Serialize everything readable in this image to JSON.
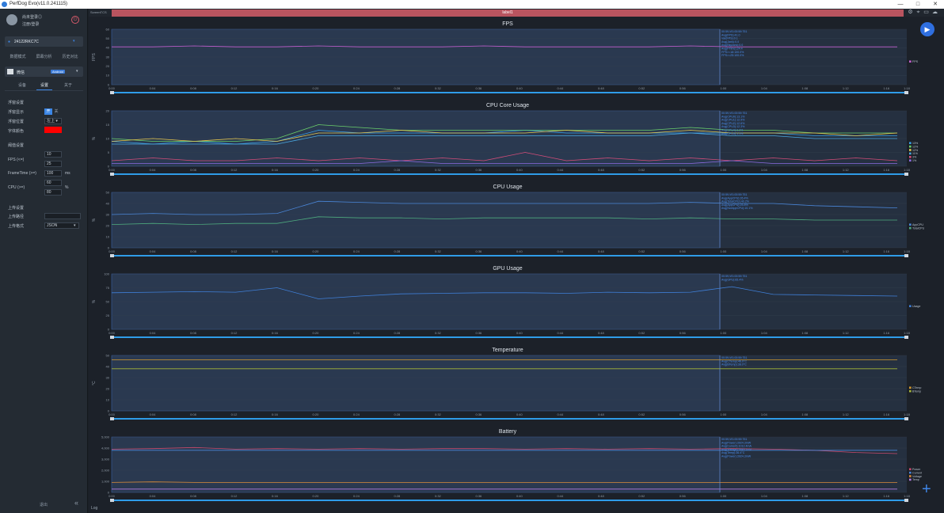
{
  "window": {
    "title": "PerfDog Evo(v11.0.241115)",
    "controls": [
      "—",
      "□",
      "✕"
    ]
  },
  "sidebar": {
    "user_line1": "尚未登录◎",
    "user_line2": "注册/登录",
    "device_name": "24122RKC7C",
    "mode_tabs": [
      "数据模式",
      "屏幕分析",
      "历史对比"
    ],
    "app_name": "微信",
    "app_badge": "Android",
    "sub_tabs": [
      "设备",
      "设置",
      "关于"
    ],
    "float_section": "浮窗设置",
    "float_rows": [
      {
        "label": "浮窗显示",
        "on": "开",
        "off": "关"
      },
      {
        "label": "浮窗位置",
        "value": "左上 ▾"
      },
      {
        "label": "字体颜色",
        "value": ""
      }
    ],
    "threshold_section": "阈值设置",
    "thresholds": [
      {
        "label": "FPS (<=)",
        "values": [
          "10",
          "25"
        ],
        "unit": ""
      },
      {
        "label": "FrameTime (>=)",
        "values": [
          "100"
        ],
        "unit": "ms"
      },
      {
        "label": "CPU (>=)",
        "values": [
          "60",
          "80"
        ],
        "unit": "%"
      }
    ],
    "upload_section": "上传设置",
    "upload_rows": [
      {
        "label": "上传路径",
        "value": ""
      },
      {
        "label": "上传格式",
        "value": "JSON"
      }
    ],
    "logout": "退出",
    "collapse_icon": "«"
  },
  "main": {
    "small_tab": "ScreenTCS",
    "active_tab": "label1",
    "log_label": "Log",
    "x_ticks": [
      "0:00",
      "0:04",
      "0:08",
      "0:12",
      "0:16",
      "0:20",
      "0:24",
      "0:28",
      "0:32",
      "0:36",
      "0:40",
      "0:44",
      "0:48",
      "0:52",
      "0:56",
      "1:00",
      "1:04",
      "1:08",
      "1:12",
      "1:16"
    ],
    "end_tick": "1:18"
  },
  "chart_data": [
    {
      "type": "line",
      "title": "FPS",
      "ylabel": "FPS",
      "y_ticks": [
        "0",
        "10",
        "20",
        "30",
        "40",
        "50",
        "60"
      ],
      "ylim": [
        0,
        60
      ],
      "series": [
        {
          "color": "#c35fcf",
          "values": [
            41,
            41,
            42,
            41,
            41,
            42,
            41,
            41,
            41,
            42,
            41,
            41,
            41,
            41,
            42,
            41,
            41,
            41,
            41,
            41
          ]
        }
      ],
      "info_lines": [
        "00:59,Vf1:00:59:751",
        "Avg(FPS):41.0",
        "Var(FPS):0.1",
        "Avg(Jank):0.0",
        "Avg(BigJank):0.0",
        "Avg(FTime):24.4",
        "FPS>=18:100.0%",
        "FPS>=25:100.0%"
      ],
      "legend": [
        "FPS"
      ],
      "legend_colors": [
        "#c35fcf"
      ]
    },
    {
      "type": "line",
      "title": "CPU Core Usage",
      "ylabel": "%",
      "y_ticks": [
        "0",
        "5",
        "10",
        "15",
        "20"
      ],
      "ylim": [
        0,
        20
      ],
      "series": [
        {
          "color": "#3aa0e8",
          "values": [
            9,
            8,
            9,
            8,
            9,
            13,
            12,
            12,
            12,
            12,
            13,
            12,
            12,
            12,
            12,
            12,
            12,
            11,
            11,
            11
          ]
        },
        {
          "color": "#6bd16b",
          "values": [
            10,
            9,
            9,
            9,
            10,
            15,
            14,
            13,
            13,
            13,
            13,
            13,
            13,
            13,
            14,
            13,
            13,
            12,
            12,
            12
          ]
        },
        {
          "color": "#e6c84f",
          "values": [
            9,
            10,
            9,
            10,
            9,
            12,
            12,
            13,
            12,
            12,
            12,
            13,
            12,
            12,
            13,
            12,
            12,
            12,
            11,
            12
          ]
        },
        {
          "color": "#4aa8e0",
          "values": [
            8,
            8,
            8,
            8,
            8,
            11,
            11,
            11,
            11,
            11,
            11,
            11,
            11,
            11,
            12,
            11,
            11,
            10,
            10,
            10
          ]
        },
        {
          "color": "#d64d7a",
          "values": [
            2,
            3,
            2,
            2,
            3,
            2,
            3,
            2,
            3,
            2,
            5,
            2,
            3,
            2,
            3,
            2,
            3,
            2,
            3,
            2
          ]
        },
        {
          "color": "#8c6be0",
          "values": [
            1,
            1,
            1,
            1,
            1,
            1,
            1,
            2,
            1,
            1,
            1,
            1,
            1,
            1,
            1,
            2,
            1,
            1,
            1,
            1
          ]
        }
      ],
      "info_lines": [
        "00:59,Vf1:00:59:751",
        "Avg(CPU0):13.1%",
        "Avg(CPU1):12.9%",
        "Avg(CPU2):12.6%",
        "Avg(CPU3):12.3%",
        "Avg(CPU4):3.2%",
        "Avg(CPU5):1.1%"
      ],
      "legend": [
        "13%",
        "12%",
        "12%",
        "11%",
        "3%",
        "1%"
      ],
      "legend_colors": [
        "#3aa0e8",
        "#6bd16b",
        "#e6c84f",
        "#4aa8e0",
        "#d64d7a",
        "#8c6be0"
      ]
    },
    {
      "type": "line",
      "title": "CPU Usage",
      "ylabel": "%",
      "y_ticks": [
        "0",
        "10",
        "20",
        "30",
        "40",
        "50"
      ],
      "ylim": [
        0,
        50
      ],
      "series": [
        {
          "color": "#4a86d8",
          "values": [
            30,
            31,
            30,
            30,
            31,
            42,
            41,
            40,
            40,
            40,
            40,
            40,
            40,
            40,
            41,
            40,
            40,
            38,
            37,
            36
          ]
        },
        {
          "color": "#4eaa7e",
          "values": [
            21,
            22,
            21,
            22,
            22,
            28,
            27,
            27,
            26,
            27,
            27,
            27,
            27,
            26,
            27,
            26,
            26,
            25,
            25,
            25
          ]
        }
      ],
      "info_lines": [
        "00:59,Vf1:00:59:751",
        "Avg(AppCPU):26.4%",
        "Avg(TotalCPU):40.2%",
        "Avg(AppCPU):25.8%",
        "Avg(NorAppCPU):10.1%"
      ],
      "legend": [
        "AppCPU",
        "TotalCPU"
      ],
      "legend_colors": [
        "#4a86d8",
        "#4eaa7e"
      ]
    },
    {
      "type": "line",
      "title": "GPU Usage",
      "ylabel": "%",
      "y_ticks": [
        "0",
        "25",
        "50",
        "75",
        "100"
      ],
      "ylim": [
        0,
        100
      ],
      "series": [
        {
          "color": "#3f7fd8",
          "values": [
            66,
            67,
            68,
            67,
            75,
            55,
            60,
            64,
            65,
            66,
            66,
            65,
            67,
            66,
            67,
            77,
            63,
            62,
            61,
            60
          ]
        }
      ],
      "info_lines": [
        "00:59,Vf1:00:59:751",
        "Avg(GPU):65.4%"
      ],
      "legend": [
        "Usage"
      ],
      "legend_colors": [
        "#3f7fd8"
      ]
    },
    {
      "type": "line",
      "title": "Temperature",
      "ylabel": "°C",
      "y_ticks": [
        "0",
        "10",
        "20",
        "30",
        "40",
        "50"
      ],
      "ylim": [
        0,
        50
      ],
      "series": [
        {
          "color": "#d49a2e",
          "values": [
            46,
            46,
            46,
            46,
            46,
            46,
            46,
            46,
            46,
            46,
            46,
            46,
            46,
            46,
            46,
            46,
            46,
            46,
            46,
            46
          ]
        },
        {
          "color": "#a8b83a",
          "values": [
            38,
            38,
            38,
            38,
            38,
            38,
            38,
            38,
            38,
            38,
            38,
            38,
            38,
            38,
            38,
            38,
            38,
            38,
            38,
            38
          ]
        }
      ],
      "info_lines": [
        "00:59,Vf1:00:59:751",
        "Avg(CTemp):46.0°C",
        "Avg(BTemp):38.0°C"
      ],
      "legend": [
        "CTemp",
        "BTemp"
      ],
      "legend_colors": [
        "#d49a2e",
        "#a8b83a"
      ]
    },
    {
      "type": "line",
      "title": "Battery",
      "ylabel": "",
      "y_ticks": [
        "0",
        "1,000",
        "2,000",
        "3,000",
        "4,000",
        "5,000"
      ],
      "ylim": [
        0,
        5000
      ],
      "series": [
        {
          "color": "#c84b6e",
          "values": [
            3900,
            3950,
            4050,
            3900,
            3950,
            3900,
            3950,
            3900,
            3950,
            3950,
            3900,
            3950,
            3900,
            3950,
            3900,
            3950,
            3900,
            3800,
            3600,
            3500
          ]
        },
        {
          "color": "#4a86d8",
          "values": [
            3800,
            3800,
            3800,
            3800,
            3800,
            3800,
            3800,
            3800,
            3800,
            3800,
            3800,
            3800,
            3800,
            3800,
            3800,
            3800,
            3800,
            3800,
            3800,
            3800
          ]
        },
        {
          "color": "#d98c3a",
          "values": [
            900,
            950,
            900,
            900,
            900,
            900,
            900,
            900,
            900,
            900,
            900,
            900,
            900,
            900,
            900,
            900,
            900,
            900,
            900,
            900
          ]
        },
        {
          "color": "#b57be0",
          "values": [
            300,
            300,
            300,
            300,
            300,
            300,
            300,
            300,
            300,
            300,
            300,
            300,
            300,
            300,
            300,
            300,
            300,
            300,
            300,
            300
          ]
        }
      ],
      "info_lines": [
        "00:59,Vf1:00:59:751",
        "Avg(Power):3924.3mW",
        "Avg(Current):1012.4mA",
        "Avg(Voltage):3849.1mV",
        "Avg(Temp):36.4°C",
        "Avg(Power):3924.3mW"
      ],
      "legend": [
        "Power",
        "Current",
        "Voltage",
        "Temp"
      ],
      "legend_colors": [
        "#c84b6e",
        "#4a86d8",
        "#d98c3a",
        "#b57be0"
      ]
    }
  ]
}
